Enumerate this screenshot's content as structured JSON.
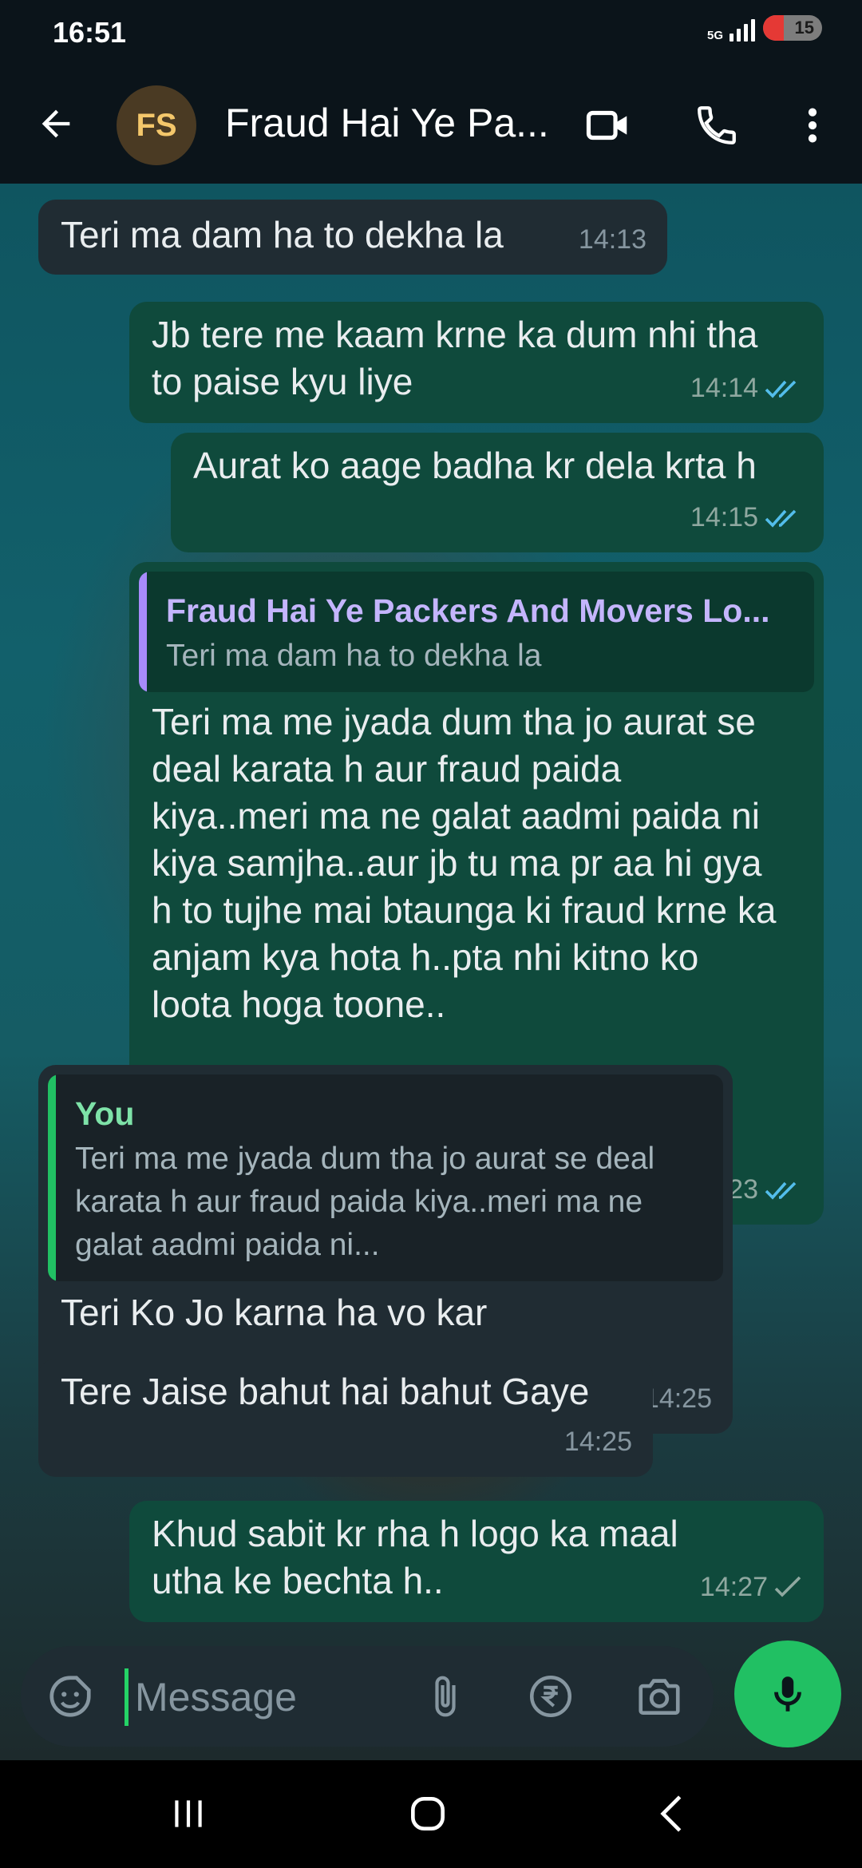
{
  "status_bar": {
    "time": "16:51",
    "network_label": "5G",
    "battery": "15",
    "battery_low_color": "#e53935"
  },
  "header": {
    "avatar_initials": "FS",
    "contact_name": "Fraud Hai Ye Pa...",
    "icons": [
      "back-arrow-icon",
      "video-call-icon",
      "voice-call-icon",
      "more-options-icon"
    ]
  },
  "messages": [
    {
      "direction": "in",
      "text": "Teri ma dam ha to dekha la",
      "time": "14:13"
    },
    {
      "direction": "out",
      "text": "Jb tere me kaam krne ka dum nhi tha to paise kyu liye",
      "time": "14:14",
      "status": "read"
    },
    {
      "direction": "out",
      "text": "Aurat ko aage badha kr dela krta h",
      "time": "14:15",
      "status": "read"
    },
    {
      "direction": "out",
      "quote_author": "Fraud Hai Ye Packers And Movers Lo...",
      "quote_text": "Teri ma dam ha to dekha la",
      "text": "Teri ma me jyada dum tha jo aurat se deal karata h aur fraud paida kiya..meri ma ne galat aadmi paida ni kiya samjha..aur jb tu ma pr aa hi gya h to tujhe mai btaunga ki fraud krne ka anjam kya hota h..pta nhi kitno ko loota hoga toone..",
      "time": "14:23",
      "status": "read"
    },
    {
      "direction": "in",
      "quote_author": "You",
      "quote_text": "Teri ma me jyada dum tha jo aurat se deal karata h aur fraud paida kiya..meri ma ne galat aadmi paida ni...",
      "text": "Teri Ko Jo karna ha vo kar",
      "time": "14:25"
    },
    {
      "direction": "in",
      "text": "Tere Jaise bahut hai bahut Gaye",
      "time": "14:25"
    },
    {
      "direction": "out",
      "text": "Khud sabit kr rha h logo ka maal utha ke bechta h..",
      "time": "14:27",
      "status": "sent"
    }
  ],
  "input": {
    "placeholder": "Message",
    "icons": [
      "sticker-icon",
      "attachment-icon",
      "rupee-payment-icon",
      "camera-icon",
      "microphone-icon"
    ]
  },
  "colors": {
    "accent": "#21c063",
    "outgoing_bubble": "#0f4a3c",
    "incoming_bubble": "#202c33",
    "read_ticks": "#53bdeb",
    "quote_bar_out": "#a78bfa",
    "quote_author_out": "#c4b5fd",
    "quote_bar_in": "#21c063",
    "quote_author_in": "#7ee2a8"
  }
}
